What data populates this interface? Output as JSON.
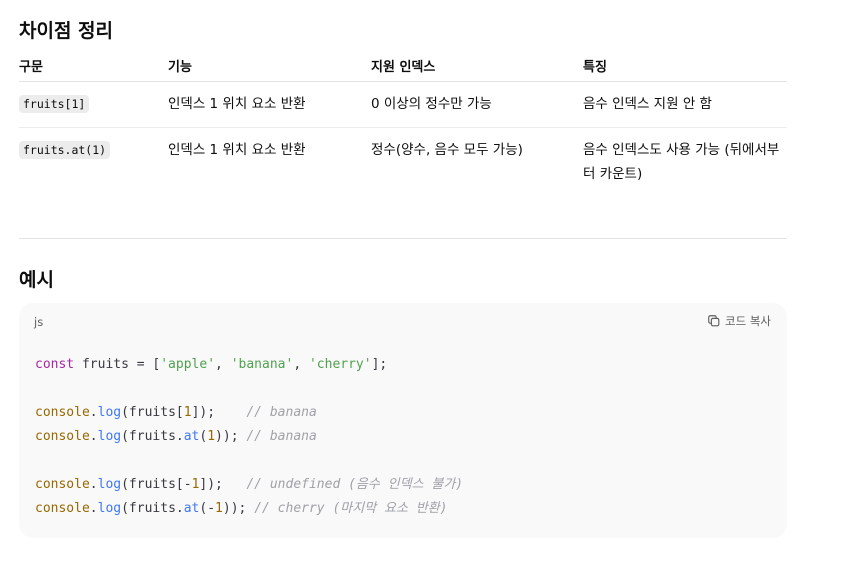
{
  "section_diff": {
    "title": "차이점 정리",
    "headers": [
      "구문",
      "기능",
      "지원 인덱스",
      "특징"
    ],
    "rows": [
      {
        "syntax": "fruits[1]",
        "function": "인덱스 1 위치 요소 반환",
        "index": "0 이상의 정수만 가능",
        "feature": "음수 인덱스 지원 안 함"
      },
      {
        "syntax": "fruits.at(1)",
        "function": "인덱스 1 위치 요소 반환",
        "index": "정수(양수, 음수 모두 가능)",
        "feature": "음수 인덱스도 사용 가능 (뒤에서부터 카운트)"
      }
    ]
  },
  "section_example": {
    "title": "예시",
    "code_lang": "js",
    "copy_label": "코드 복사",
    "code_lines": [
      {
        "t1": "const",
        "t2": " fruits = [",
        "s1": "'apple'",
        "t3": ", ",
        "s2": "'banana'",
        "t4": ", ",
        "s3": "'cherry'",
        "t5": "];"
      },
      {},
      {
        "obj": "console",
        "dot": ".",
        "fn": "log",
        "a": "(fruits[",
        "n": "1",
        "b": "]);    ",
        "cmt": "// banana"
      },
      {
        "obj": "console",
        "dot": ".",
        "fn": "log",
        "a": "(fruits.",
        "fn2": "at",
        "a2": "(",
        "n": "1",
        "b": ")); ",
        "cmt": "// banana"
      },
      {},
      {
        "obj": "console",
        "dot": ".",
        "fn": "log",
        "a": "(fruits[-",
        "n": "1",
        "b": "]);   ",
        "cmt": "// undefined (음수 인덱스 불가)"
      },
      {
        "obj": "console",
        "dot": ".",
        "fn": "log",
        "a": "(fruits.",
        "fn2": "at",
        "a2": "(-",
        "n": "1",
        "b": ")); ",
        "cmt": "// cherry (마지막 요소 반환)"
      }
    ]
  },
  "colors": {
    "keyword": "#a626a4",
    "string": "#50a14f",
    "object": "#986801",
    "function": "#4078f2",
    "comment": "#a0a1a7"
  },
  "icons": {
    "copy": "copy-icon"
  }
}
